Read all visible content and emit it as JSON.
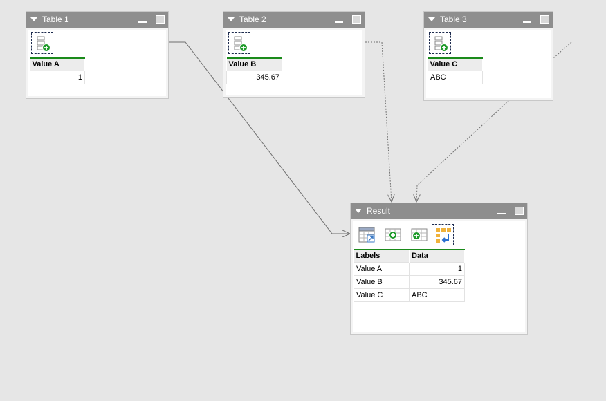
{
  "tables": [
    {
      "title": "Table 1",
      "column": "Value A",
      "value": "1"
    },
    {
      "title": "Table 2",
      "column": "Value B",
      "value": "345.67"
    },
    {
      "title": "Table 3",
      "column": "Value C",
      "value": "ABC"
    }
  ],
  "result": {
    "title": "Result",
    "headers": [
      "Labels",
      "Data"
    ],
    "rows": [
      {
        "label": "Value A",
        "data": "1"
      },
      {
        "label": "Value B",
        "data": "345.67"
      },
      {
        "label": "Value C",
        "data": "ABC"
      }
    ]
  },
  "icons": {
    "collapse": "triangle-down-icon",
    "minimize": "minimize-icon",
    "maximize": "maximize-icon",
    "add_row": "add-row-icon",
    "export": "table-export-icon",
    "add_column": "add-column-icon",
    "add_table": "add-table-icon",
    "transpose": "transpose-icon"
  },
  "colors": {
    "background": "#e6e6e6",
    "titlebar": "#8e8e8e",
    "header_rule": "#1a8a1a",
    "add_badge": "#1e9a2a",
    "connector": "#6f6f6f"
  }
}
